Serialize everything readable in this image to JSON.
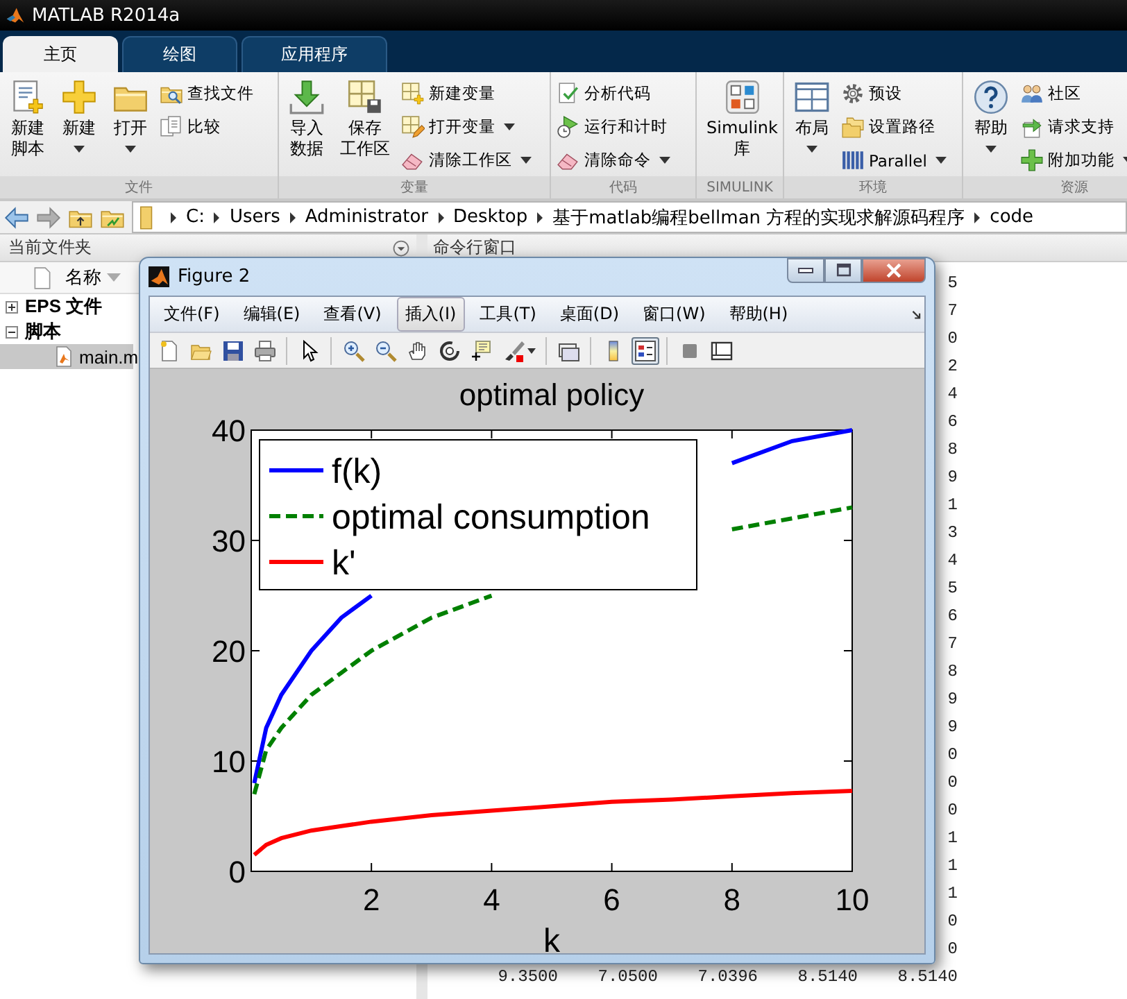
{
  "window": {
    "title": "MATLAB R2014a"
  },
  "tabs": [
    {
      "label": "主页",
      "selected": true
    },
    {
      "label": "绘图",
      "selected": false
    },
    {
      "label": "应用程序",
      "selected": false
    }
  ],
  "ribbon": {
    "sections": [
      {
        "label": "文件",
        "items": [
          {
            "kind": "big",
            "label": [
              "新建",
              "脚本"
            ],
            "dropdown": false
          },
          {
            "kind": "big",
            "label": [
              "新建"
            ],
            "dropdown": true
          },
          {
            "kind": "big",
            "label": [
              "打开"
            ],
            "dropdown": true
          },
          {
            "kind": "stack",
            "buttons": [
              {
                "label": "查找文件",
                "dropdown": false
              },
              {
                "label": "比较",
                "dropdown": false
              }
            ]
          }
        ]
      },
      {
        "label": "变量",
        "items": [
          {
            "kind": "big",
            "label": [
              "导入",
              "数据"
            ],
            "dropdown": false
          },
          {
            "kind": "big",
            "label": [
              "保存",
              "工作区"
            ],
            "dropdown": false
          },
          {
            "kind": "stack",
            "buttons": [
              {
                "label": "新建变量",
                "dropdown": false
              },
              {
                "label": "打开变量",
                "dropdown": true
              },
              {
                "label": "清除工作区",
                "dropdown": true
              }
            ]
          }
        ]
      },
      {
        "label": "代码",
        "items": [
          {
            "kind": "stack",
            "buttons": [
              {
                "label": "分析代码",
                "dropdown": false
              },
              {
                "label": "运行和计时",
                "dropdown": false
              },
              {
                "label": "清除命令",
                "dropdown": true
              }
            ]
          }
        ]
      },
      {
        "label": "SIMULINK",
        "items": [
          {
            "kind": "big",
            "label": [
              "Simulink",
              "库"
            ],
            "dropdown": false
          }
        ]
      },
      {
        "label": "环境",
        "items": [
          {
            "kind": "big",
            "label": [
              "布局"
            ],
            "dropdown": true
          },
          {
            "kind": "stack",
            "buttons": [
              {
                "label": "预设",
                "dropdown": false
              },
              {
                "label": "设置路径",
                "dropdown": false
              },
              {
                "label": "Parallel",
                "dropdown": true
              }
            ]
          }
        ]
      },
      {
        "label": "资源",
        "items": [
          {
            "kind": "big",
            "label": [
              "帮助"
            ],
            "dropdown": true
          },
          {
            "kind": "stack",
            "buttons": [
              {
                "label": "社区",
                "dropdown": false
              },
              {
                "label": "请求支持",
                "dropdown": false
              },
              {
                "label": "附加功能",
                "dropdown": true
              }
            ]
          }
        ]
      }
    ]
  },
  "address_bar": {
    "path": [
      "C:",
      "Users",
      "Administrator",
      "Desktop",
      "基于matlab编程bellman 方程的实现求解源码程序",
      "code"
    ]
  },
  "current_folder": {
    "title": "当前文件夹",
    "column": "名称",
    "tree": [
      {
        "kind": "group",
        "label": "EPS 文件",
        "expanded": false,
        "selected": false
      },
      {
        "kind": "group",
        "label": "脚本",
        "expanded": true,
        "selected": false,
        "children": [
          {
            "kind": "file",
            "label": "main.m",
            "selected": true
          }
        ]
      }
    ]
  },
  "command_window": {
    "title": "命令行窗口",
    "lines": [
      "5",
      "7",
      "0",
      "2",
      "4",
      "6",
      "8",
      "9",
      "1",
      "3",
      "4",
      "5",
      "6",
      "7",
      "8",
      "9",
      "9",
      "0",
      "0",
      "0",
      "1",
      "1",
      "1",
      "0",
      "0",
      "9.3500    7.0500    7.0396    8.5140    8.5140"
    ]
  },
  "figure": {
    "title": "Figure 2",
    "menu": [
      {
        "label": "文件(F)",
        "highlighted": false
      },
      {
        "label": "编辑(E)",
        "highlighted": false
      },
      {
        "label": "查看(V)",
        "highlighted": false
      },
      {
        "label": "插入(I)",
        "highlighted": true
      },
      {
        "label": "工具(T)",
        "highlighted": false
      },
      {
        "label": "桌面(D)",
        "highlighted": false
      },
      {
        "label": "窗口(W)",
        "highlighted": false
      },
      {
        "label": "帮助(H)",
        "highlighted": false
      }
    ],
    "toolbar_groups": [
      {
        "buttons": [
          {
            "pressed": false
          },
          {
            "pressed": false
          },
          {
            "pressed": false
          },
          {
            "pressed": false
          }
        ]
      },
      {
        "buttons": [
          {
            "pressed": false
          }
        ]
      },
      {
        "buttons": [
          {
            "pressed": false
          },
          {
            "pressed": false
          },
          {
            "pressed": false
          },
          {
            "pressed": false
          },
          {
            "pressed": false
          },
          {
            "pressed": false
          }
        ]
      },
      {
        "buttons": [
          {
            "pressed": false
          }
        ]
      },
      {
        "buttons": [
          {
            "pressed": false
          },
          {
            "pressed": true
          }
        ]
      },
      {
        "buttons": [
          {
            "pressed": false
          },
          {
            "pressed": false
          }
        ]
      }
    ],
    "plot": {
      "chart_data": {
        "type": "line",
        "title": "optimal policy",
        "xlabel": "k",
        "x": [
          0.05,
          0.25,
          0.5,
          1,
          1.5,
          2,
          3,
          4,
          5,
          6,
          7,
          8,
          9,
          10
        ],
        "series": [
          {
            "name": "f(k)",
            "color": "#0000ff",
            "line_style": "solid",
            "values": [
              8,
              13,
              16,
              20,
              23,
              25,
              null,
              null,
              null,
              null,
              null,
              37,
              39,
              40
            ]
          },
          {
            "name": "optimal consumption",
            "color": "#008000",
            "line_style": "dashed",
            "values": [
              7,
              11,
              13,
              16,
              18,
              20,
              23,
              25,
              null,
              null,
              null,
              31,
              32,
              33
            ]
          },
          {
            "name": "k'",
            "color": "#ff0000",
            "line_style": "solid",
            "values": [
              1.5,
              2.4,
              3,
              3.7,
              4.1,
              4.5,
              5.1,
              5.5,
              5.9,
              6.3,
              6.5,
              6.8,
              7.1,
              7.3
            ]
          }
        ],
        "legend": "upper left",
        "xlim": [
          0,
          10
        ],
        "ylim": [
          0,
          40
        ],
        "xticks": [
          2,
          4,
          6,
          8,
          10
        ],
        "yticks": [
          0,
          10,
          20,
          30,
          40
        ]
      }
    }
  }
}
